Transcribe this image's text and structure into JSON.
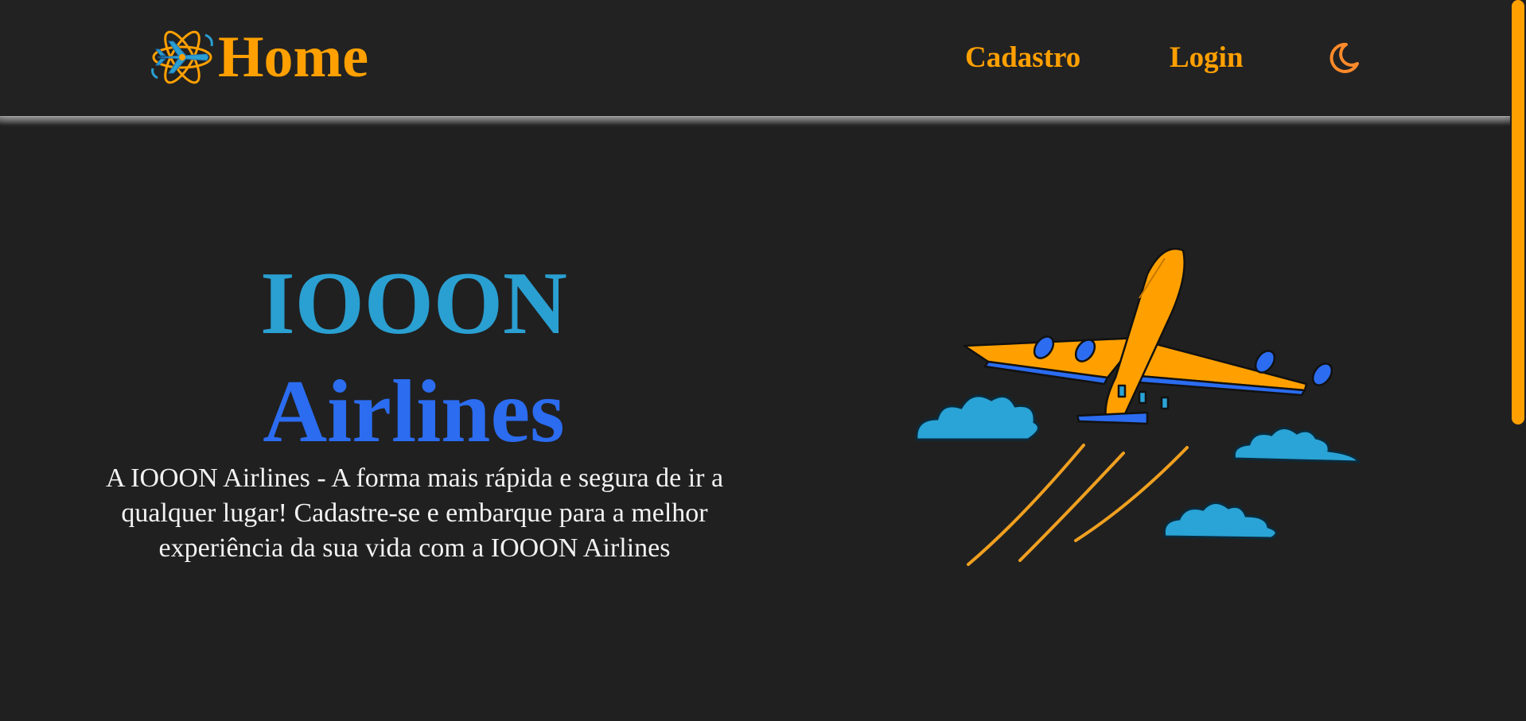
{
  "header": {
    "brand_label": "Home",
    "logo_icon": "atom-airplane-logo-icon",
    "nav": {
      "cadastro": "Cadastro",
      "login": "Login"
    },
    "theme_toggle_icon": "moon-icon"
  },
  "hero": {
    "title_line1": "IOOON",
    "title_line2": "Airlines",
    "description": "A IOOON Airlines - A forma mais rápida e segura de ir a qualquer lugar! Cadastre-se e embarque para a melhor experiência da sua vida com a IOOON Airlines",
    "illustration_icon": "airplane-with-clouds-illustration"
  },
  "colors": {
    "background": "#202020",
    "accent_orange": "#ffa000",
    "title_cyan": "#2a9fd1",
    "title_blue": "#2b6cf0",
    "text": "#f2f2f2",
    "moon": "#ff8a2a"
  }
}
